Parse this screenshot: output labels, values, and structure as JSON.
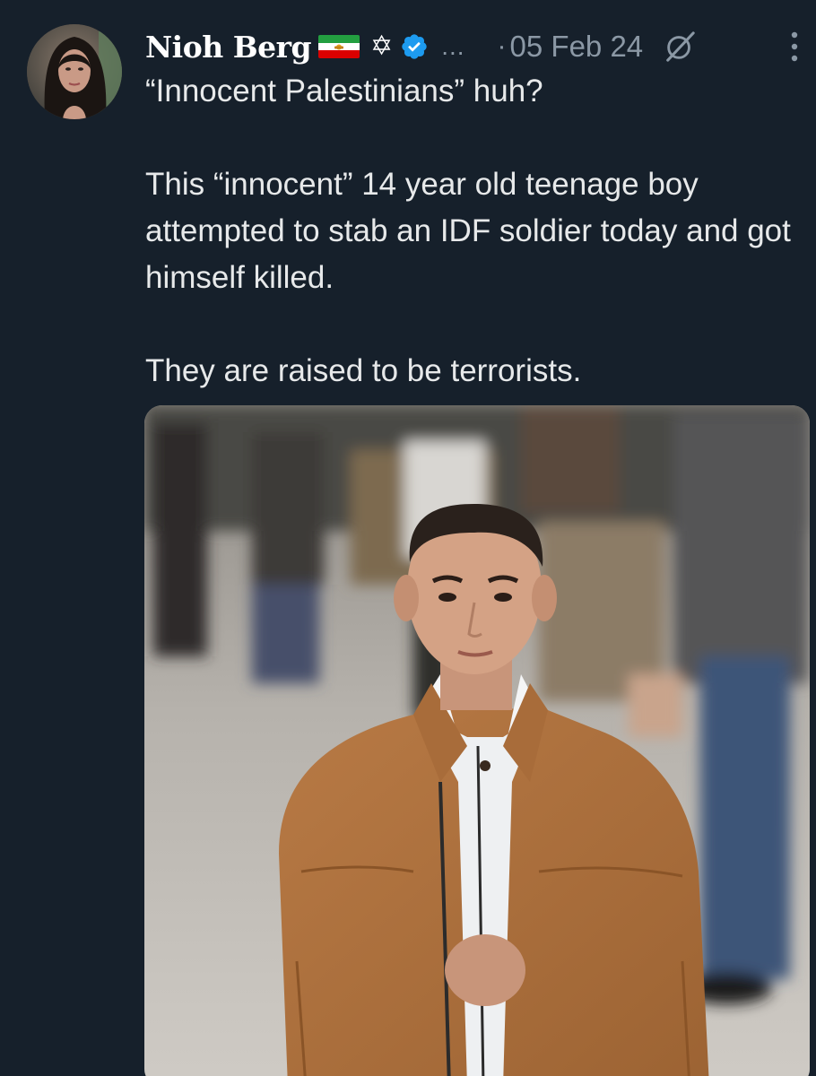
{
  "tweet": {
    "author": {
      "display_name": "Nioh Berg",
      "flag_icon": "iran-lion-and-sun-flag-icon",
      "symbol": "✡",
      "verified": true,
      "truncation": "..."
    },
    "separator": "·",
    "date": "05 Feb 24",
    "text": {
      "line1": "“Innocent Palestinians” huh?",
      "para2": "This “innocent” 14 year old teenage boy attempted to stab an IDF soldier today and got himself killed.",
      "para3": "They are raised to be terrorists."
    },
    "media": {
      "type": "photo"
    }
  },
  "colors": {
    "background": "#16202b",
    "text": "#e7e9ea",
    "secondary": "#8b98a5",
    "verified_blue": "#1d9bf0"
  }
}
